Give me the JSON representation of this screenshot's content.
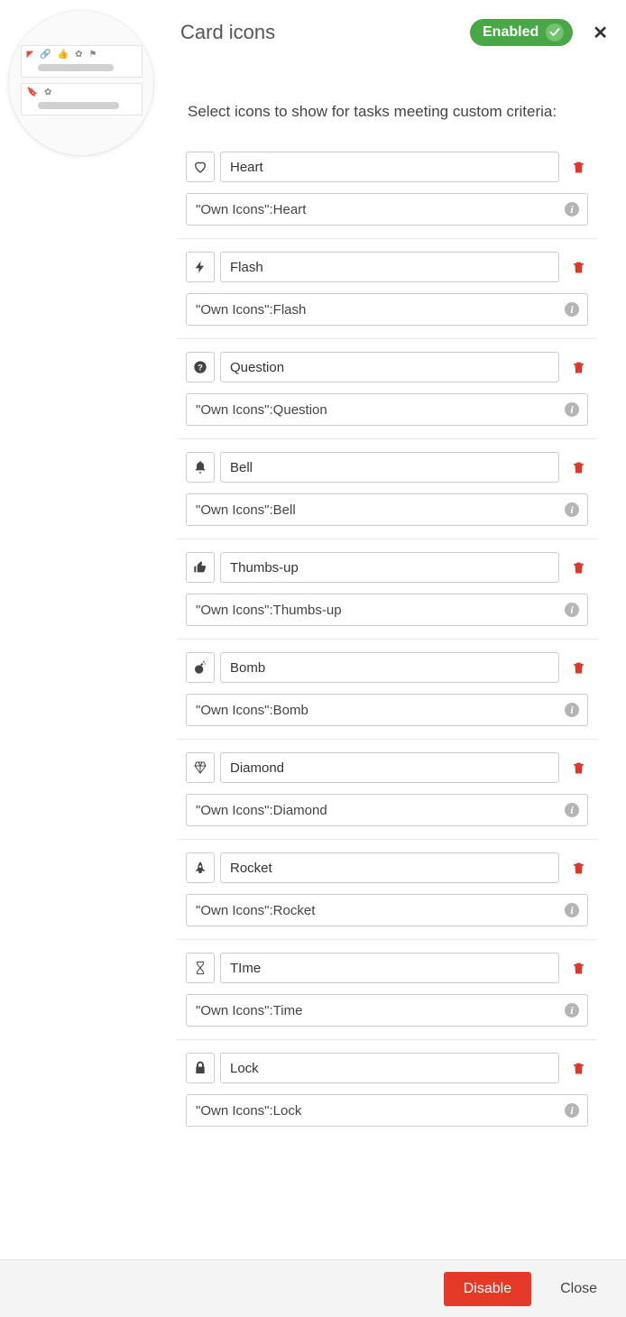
{
  "header": {
    "title": "Card icons",
    "status_label": "Enabled",
    "close_glyph": "✕"
  },
  "subtitle": "Select icons to show for tasks meeting custom criteria:",
  "info_glyph": "i",
  "rules": [
    {
      "icon": "heart",
      "name": "Heart",
      "criteria": "\"Own Icons\":Heart"
    },
    {
      "icon": "flash",
      "name": "Flash",
      "criteria": "\"Own Icons\":Flash"
    },
    {
      "icon": "question",
      "name": "Question",
      "criteria": "\"Own Icons\":Question"
    },
    {
      "icon": "bell",
      "name": "Bell",
      "criteria": "\"Own Icons\":Bell"
    },
    {
      "icon": "thumbs-up",
      "name": "Thumbs-up",
      "criteria": "\"Own Icons\":Thumbs-up"
    },
    {
      "icon": "bomb",
      "name": "Bomb",
      "criteria": "\"Own Icons\":Bomb"
    },
    {
      "icon": "diamond",
      "name": "Diamond",
      "criteria": "\"Own Icons\":Diamond"
    },
    {
      "icon": "rocket",
      "name": "Rocket",
      "criteria": "\"Own Icons\":Rocket"
    },
    {
      "icon": "time",
      "name": "TIme",
      "criteria": "\"Own Icons\":Time"
    },
    {
      "icon": "lock",
      "name": "Lock",
      "criteria": "\"Own Icons\":Lock"
    }
  ],
  "footer": {
    "disable_label": "Disable",
    "close_label": "Close"
  }
}
